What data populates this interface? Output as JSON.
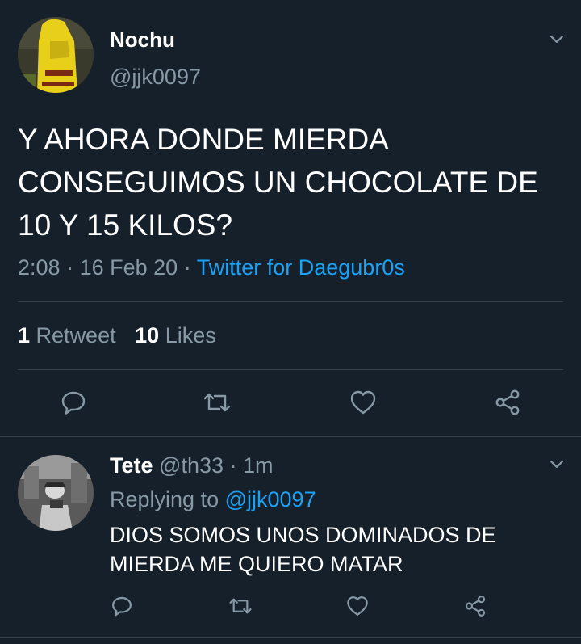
{
  "tweet": {
    "author_name": "Nochu",
    "author_handle": "@jjk0097",
    "text_line1": "Y AHORA DONDE MIERDA",
    "text_line2": "CONSEGUIMOS UN CHOCOLATE DE",
    "text_line3": "10 Y 15 KILOS?",
    "time": "2:08",
    "sep1": "·",
    "date": "16 Feb 20",
    "sep2": "·",
    "source": "Twitter for Daegubr0s",
    "retweet_count": "1",
    "retweet_label": "Retweet",
    "like_count": "10",
    "like_label": "Likes"
  },
  "reply": {
    "author_name": "Tete",
    "author_handle": "@th33",
    "sep": "·",
    "time": "1m",
    "replying_prefix": "Replying to",
    "replying_handle": "@jjk0097",
    "text_line1": "DIOS SOMOS UNOS DOMINADOS DE",
    "text_line2": "MIERDA ME QUIERO MATAR"
  },
  "colors": {
    "background": "#15202b",
    "text": "#ffffff",
    "muted": "#8899a6",
    "accent": "#1da1f2",
    "divider": "#38444d"
  },
  "icons": {
    "reply": "reply-icon",
    "retweet": "retweet-icon",
    "like": "heart-icon",
    "share": "share-icon",
    "more": "chevron-down-icon"
  }
}
